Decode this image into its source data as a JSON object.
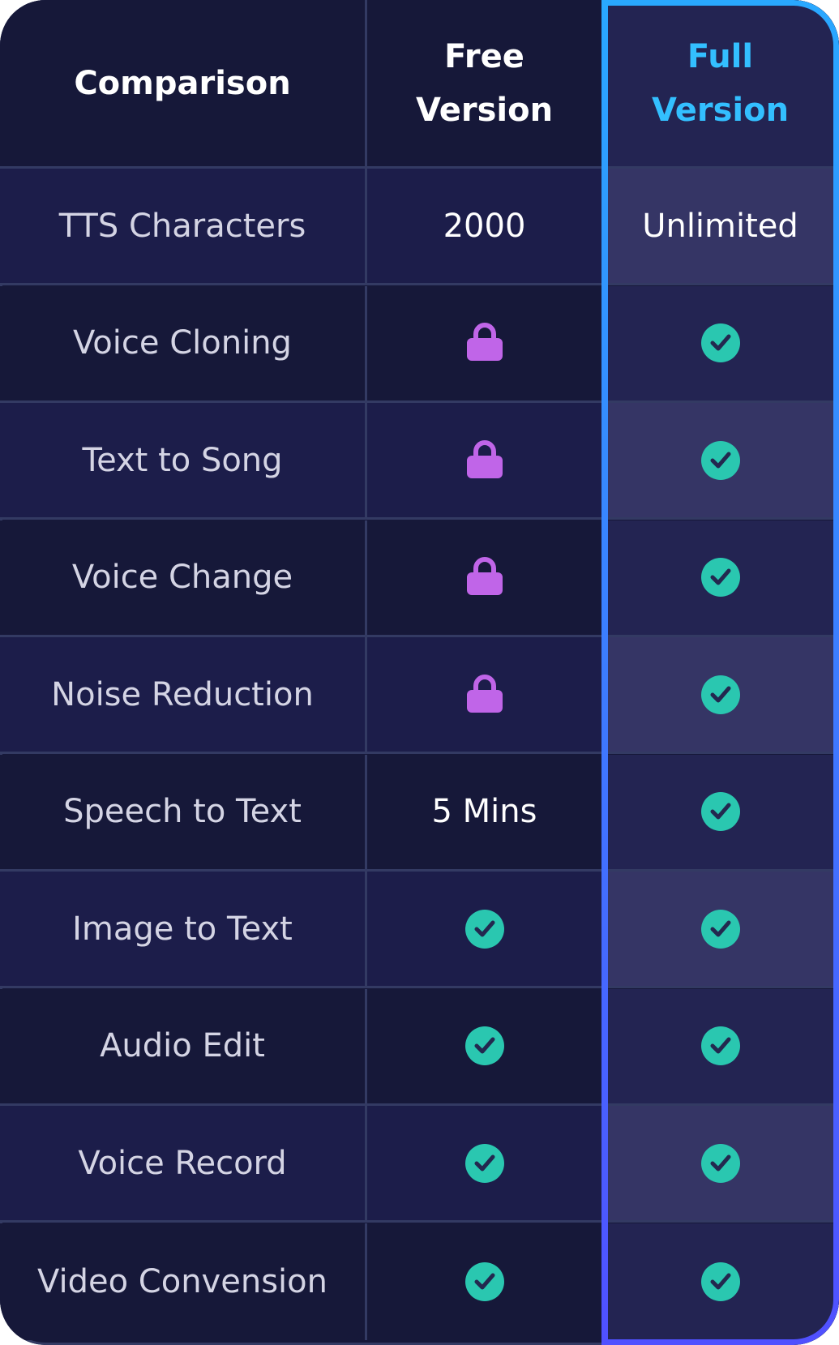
{
  "header": {
    "comparison": "Comparison",
    "free_line1": "Free",
    "free_line2": "Version",
    "full_line1": "Full",
    "full_line2": "Version"
  },
  "colors": {
    "accent": "#33bfff",
    "check": "#2ac7b0",
    "lock": "#c065e8",
    "border_top": "#29a8ff",
    "border_bottom": "#5050ff"
  },
  "rows": [
    {
      "feature": "TTS Characters",
      "free": {
        "type": "text",
        "value": "2000"
      },
      "full": {
        "type": "text",
        "value": "Unlimited"
      }
    },
    {
      "feature": "Voice Cloning",
      "free": {
        "type": "lock-icon"
      },
      "full": {
        "type": "check-icon"
      }
    },
    {
      "feature": "Text to Song",
      "free": {
        "type": "lock-icon"
      },
      "full": {
        "type": "check-icon"
      }
    },
    {
      "feature": "Voice Change",
      "free": {
        "type": "lock-icon"
      },
      "full": {
        "type": "check-icon"
      }
    },
    {
      "feature": "Noise Reduction",
      "free": {
        "type": "lock-icon"
      },
      "full": {
        "type": "check-icon"
      }
    },
    {
      "feature": "Speech to Text",
      "free": {
        "type": "text",
        "value": "5 Mins"
      },
      "full": {
        "type": "check-icon"
      }
    },
    {
      "feature": "Image to Text",
      "free": {
        "type": "check-icon"
      },
      "full": {
        "type": "check-icon"
      }
    },
    {
      "feature": "Audio Edit",
      "free": {
        "type": "check-icon"
      },
      "full": {
        "type": "check-icon"
      }
    },
    {
      "feature": "Voice Record",
      "free": {
        "type": "check-icon"
      },
      "full": {
        "type": "check-icon"
      }
    },
    {
      "feature": "Video Convension",
      "free": {
        "type": "check-icon"
      },
      "full": {
        "type": "check-icon"
      }
    }
  ]
}
